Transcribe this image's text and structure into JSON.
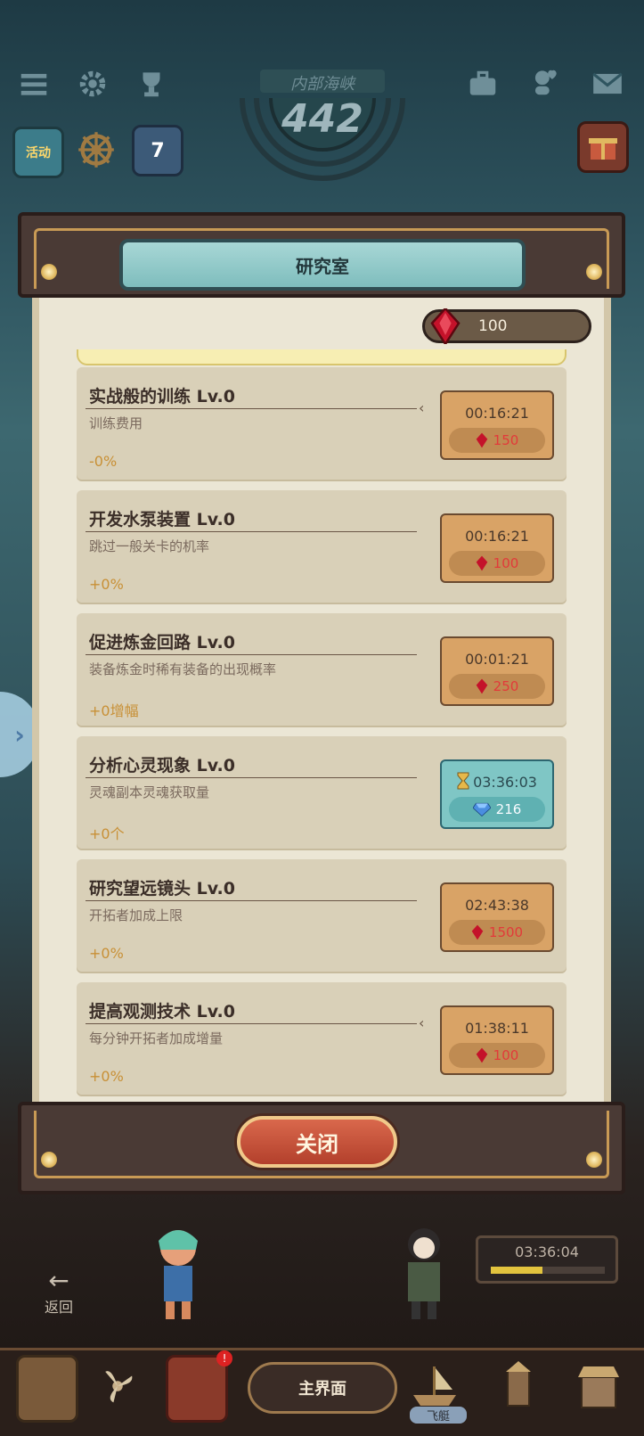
{
  "hud": {
    "area_name": "内部海峡",
    "stage_number": "442",
    "event_badge": "活动",
    "calendar_day": "7",
    "icons": [
      "menu-icon",
      "gear-icon",
      "trophy-icon",
      "toolbox-icon",
      "friends-icon",
      "mail-icon",
      "event-icon",
      "ship-wheel-icon",
      "calendar-icon",
      "gift-shop-icon"
    ]
  },
  "panel": {
    "title": "研究室",
    "currency_amount": "100",
    "close_label": "关闭",
    "items": [
      {
        "name": "实战般的训练 Lv.0",
        "desc": "训练费用",
        "bonus": "-0%",
        "time": "00:16:21",
        "cost": "150",
        "cost_type": "ruby"
      },
      {
        "name": "开发水泵装置 Lv.0",
        "desc": "跳过一般关卡的机率",
        "bonus": "+0%",
        "time": "00:16:21",
        "cost": "100",
        "cost_type": "ruby"
      },
      {
        "name": "促进炼金回路 Lv.0",
        "desc": "装备炼金时稀有装备的出现概率",
        "bonus": "+0增幅",
        "time": "00:01:21",
        "cost": "250",
        "cost_type": "ruby"
      },
      {
        "name": "分析心灵现象 Lv.0",
        "desc": "灵魂副本灵魂获取量",
        "bonus": "+0个",
        "time": "03:36:03",
        "cost": "216",
        "cost_type": "diamond"
      },
      {
        "name": "研究望远镜头 Lv.0",
        "desc": "开拓者加成上限",
        "bonus": "+0%",
        "time": "02:43:38",
        "cost": "1500",
        "cost_type": "ruby"
      },
      {
        "name": "提高观测技术 Lv.0",
        "desc": "每分钟开拓者加成增量",
        "bonus": "+0%",
        "time": "01:38:11",
        "cost": "100",
        "cost_type": "ruby"
      }
    ]
  },
  "bottom": {
    "timer": "03:36:04",
    "timer_progress": 0.45,
    "back_label": "返回",
    "main_label": "主界面",
    "ship_label": "飞艇"
  },
  "colors": {
    "ruby": "#c4122a",
    "teal_button": "#7fc6c5",
    "tan_button": "#d9a366",
    "close_button": "#c4533a"
  }
}
